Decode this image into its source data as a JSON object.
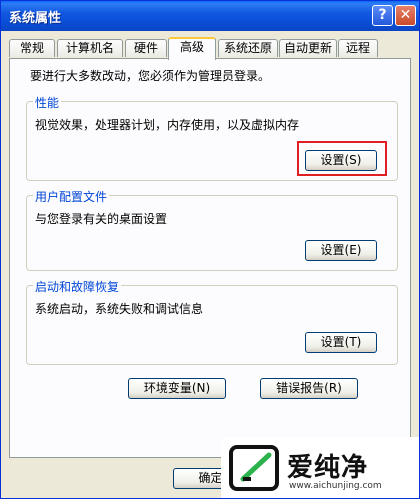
{
  "window": {
    "title": "系统属性",
    "help_label": "?",
    "close_label": "✕"
  },
  "tabs": [
    {
      "label": "常规"
    },
    {
      "label": "计算机名"
    },
    {
      "label": "硬件"
    },
    {
      "label": "高级"
    },
    {
      "label": "系统还原"
    },
    {
      "label": "自动更新"
    },
    {
      "label": "远程"
    }
  ],
  "active_tab": "高级",
  "intro": "要进行大多数改动，您必须作为管理员登录。",
  "groups": {
    "performance": {
      "title": "性能",
      "desc": "视觉效果，处理器计划，内存使用，以及虚拟内存",
      "button": "设置(S)"
    },
    "profile": {
      "title": "用户配置文件",
      "desc": "与您登录有关的桌面设置",
      "button": "设置(E)"
    },
    "recovery": {
      "title": "启动和故障恢复",
      "desc": "系统启动，系统失败和调试信息",
      "button": "设置(T)"
    }
  },
  "env_button": "环境变量(N)",
  "error_button": "错误报告(R)",
  "ok_button": "确定",
  "watermark": {
    "logo": "爱纯净",
    "url": "www.aichunjing.com"
  },
  "colors": {
    "title_bar": "#0a4fd6",
    "group_title": "#0046d5",
    "highlight": "#e02020",
    "active_tab_accent": "#ffc83c"
  }
}
